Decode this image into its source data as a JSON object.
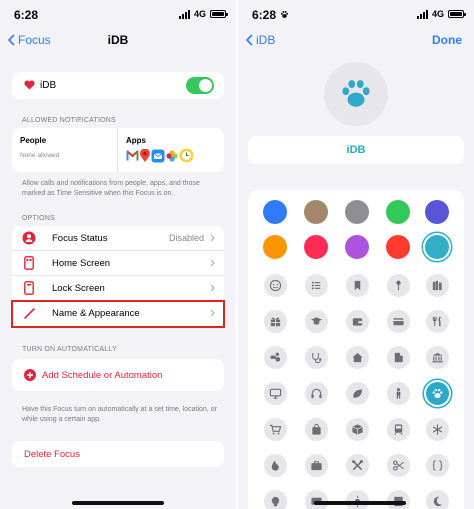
{
  "left": {
    "status": {
      "time": "6:28",
      "network": "4G"
    },
    "nav": {
      "back_label": "Focus",
      "title": "iDB"
    },
    "focus_name": "iDB",
    "allowed": {
      "section": "ALLOWED NOTIFICATIONS",
      "people_label": "People",
      "people_value": "None allowed",
      "apps_label": "Apps",
      "footnote": "Allow calls and notifications from people, apps, and those marked as Time Sensitive when this Focus is on."
    },
    "options": {
      "section": "OPTIONS",
      "items": [
        {
          "label": "Focus Status",
          "value": "Disabled"
        },
        {
          "label": "Home Screen",
          "value": ""
        },
        {
          "label": "Lock Screen",
          "value": ""
        },
        {
          "label": "Name & Appearance",
          "value": ""
        }
      ]
    },
    "automation": {
      "section": "TURN ON AUTOMATICALLY",
      "add_label": "Add Schedule or Automation",
      "footnote": "Have this Focus turn on automatically at a set time, location, or while using a certain app."
    },
    "delete_label": "Delete Focus"
  },
  "right": {
    "status": {
      "time": "6:28",
      "network": "4G"
    },
    "nav": {
      "back_label": "iDB",
      "done_label": "Done"
    },
    "name_value": "iDB",
    "accent_color": "#2fa9c7",
    "colors": [
      "#2f7cf6",
      "#a4866a",
      "#8e8e93",
      "#34c759",
      "#5856d6",
      "#ff9500",
      "#ff2d55",
      "#af52de",
      "#ff3b30",
      "#32aec9"
    ],
    "selected_color_index": 9,
    "icons": [
      "smiley-icon",
      "list-icon",
      "bookmark-icon",
      "pin-icon",
      "books-icon",
      "gift-icon",
      "graduation-cap-icon",
      "wallet-icon",
      "credit-card-icon",
      "fork-knife-icon",
      "pills-icon",
      "stethoscope-icon",
      "house-icon",
      "building-icon",
      "bank-icon",
      "monitor-icon",
      "headphones-icon",
      "leaf-icon",
      "person-icon",
      "paw-icon",
      "cart-icon",
      "bag-icon",
      "box-icon",
      "train-icon",
      "snowflake-icon",
      "flame-icon",
      "briefcase-icon",
      "tools-icon",
      "scissors-icon",
      "braces-icon",
      "lightbulb-icon",
      "tv-icon",
      "sun-icon",
      "film-icon",
      "moon-icon"
    ],
    "selected_icon_index": 19
  }
}
